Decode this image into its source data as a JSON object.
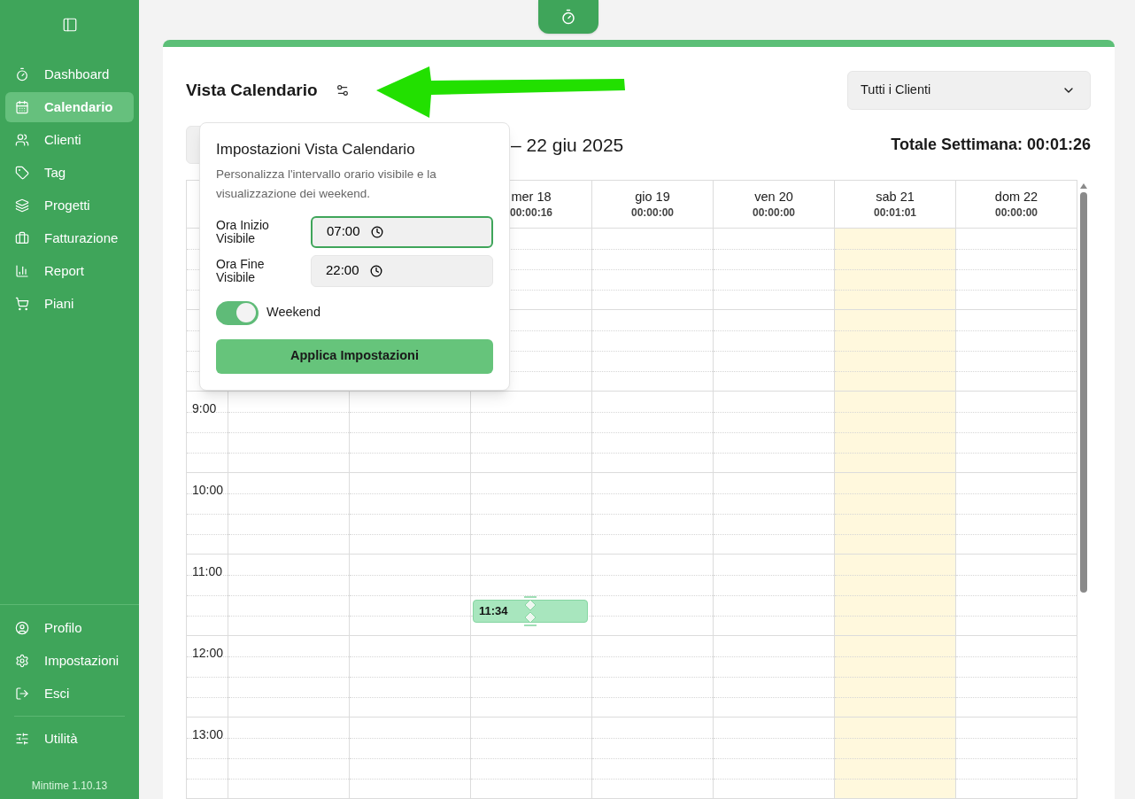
{
  "sidebar": {
    "items": [
      {
        "label": "Dashboard",
        "selected": false
      },
      {
        "label": "Calendario",
        "selected": true
      },
      {
        "label": "Clienti",
        "selected": false
      },
      {
        "label": "Tag",
        "selected": false
      },
      {
        "label": "Progetti",
        "selected": false
      },
      {
        "label": "Fatturazione",
        "selected": false
      },
      {
        "label": "Report",
        "selected": false
      },
      {
        "label": "Piani",
        "selected": false
      }
    ],
    "bottom_items": [
      {
        "label": "Profilo"
      },
      {
        "label": "Impostazioni"
      },
      {
        "label": "Esci"
      }
    ],
    "utility": {
      "label": "Utilità"
    },
    "version": "Mintime 1.10.13"
  },
  "calendar": {
    "title": "Vista Calendario",
    "client_filter": "Tutti i Clienti",
    "date_range": "– 22 giu 2025",
    "week_total": "Totale Settimana: 00:01:26",
    "columns": [
      {},
      {},
      {
        "day": "mer 18",
        "total": "00:00:16",
        "today": false,
        "events": [
          {
            "time": "11:34"
          }
        ]
      },
      {
        "day": "gio 19",
        "total": "00:00:00",
        "today": false
      },
      {
        "day": "ven 20",
        "total": "00:00:00",
        "today": false
      },
      {
        "day": "sab 21",
        "total": "00:01:01",
        "today": true
      },
      {
        "day": "dom 22",
        "total": "00:00:00",
        "today": false
      }
    ],
    "hours": [
      "9:00",
      "10:00",
      "11:00",
      "12:00",
      "13:00"
    ]
  },
  "settings_popover": {
    "title": "Impostazioni Vista Calendario",
    "description": "Personalizza l'intervallo orario visibile e la visualizzazione dei weekend.",
    "fields": [
      {
        "label": "Ora Inizio Visibile",
        "value": "07:00",
        "focused": true
      },
      {
        "label": "Ora Fine Visibile",
        "value": "22:00",
        "focused": false
      }
    ],
    "weekend": {
      "label": "Weekend",
      "on": true
    },
    "apply_button": "Applica Impostazioni"
  }
}
